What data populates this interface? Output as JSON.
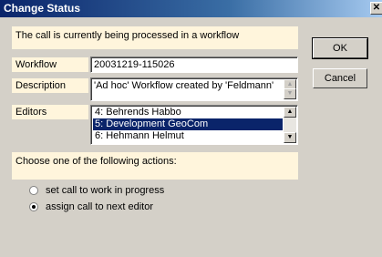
{
  "dialog": {
    "title": "Change Status",
    "close_glyph": "✕"
  },
  "banner": "The call is currently being processed in a workflow",
  "workflow": {
    "label": "Workflow",
    "value": "20031219-115026"
  },
  "description": {
    "label": "Description",
    "value": "'Ad hoc' Workflow created by 'Feldmann'"
  },
  "editors": {
    "label": "Editors",
    "items": [
      "4: Behrends Habbo",
      "5: Development GeoCom",
      "6: Hehmann Helmut"
    ],
    "selected_index": 1
  },
  "actions": {
    "prompt": "Choose one of the following actions:",
    "options": [
      {
        "label": "set call to work in progress",
        "checked": false
      },
      {
        "label": "assign call to next editor",
        "checked": true
      }
    ]
  },
  "buttons": {
    "ok": "OK",
    "cancel": "Cancel"
  },
  "icons": {
    "scroll_up": "▲",
    "scroll_down": "▼"
  }
}
